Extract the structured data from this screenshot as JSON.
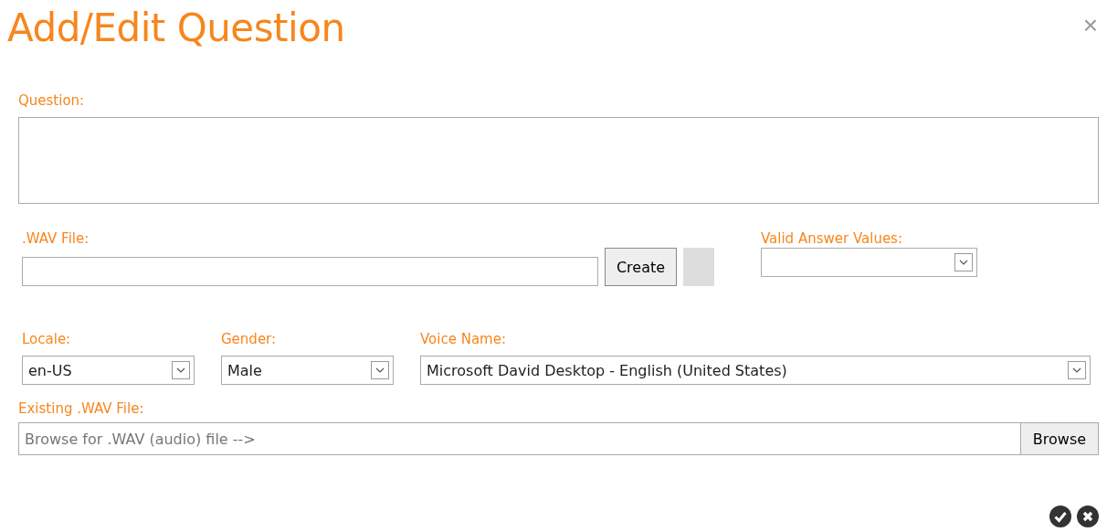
{
  "dialog": {
    "title": "Add/Edit Question",
    "close": "×"
  },
  "question": {
    "label": "Question:"
  },
  "wav_file": {
    "label": ".WAV File:",
    "button": "Create"
  },
  "valid_answer_values": {
    "label": "Valid Answer Values:"
  },
  "locale": {
    "label": "Locale:",
    "value": "en-US"
  },
  "gender": {
    "label": "Gender:",
    "value": "Male"
  },
  "voice_name": {
    "label": "Voice Name:",
    "value": "Microsoft David Desktop - English (United States)"
  },
  "existing_wav_file": {
    "label": "Existing .WAV File:",
    "placeholder": "Browse for .WAV (audio) file -->",
    "button": "Browse"
  }
}
